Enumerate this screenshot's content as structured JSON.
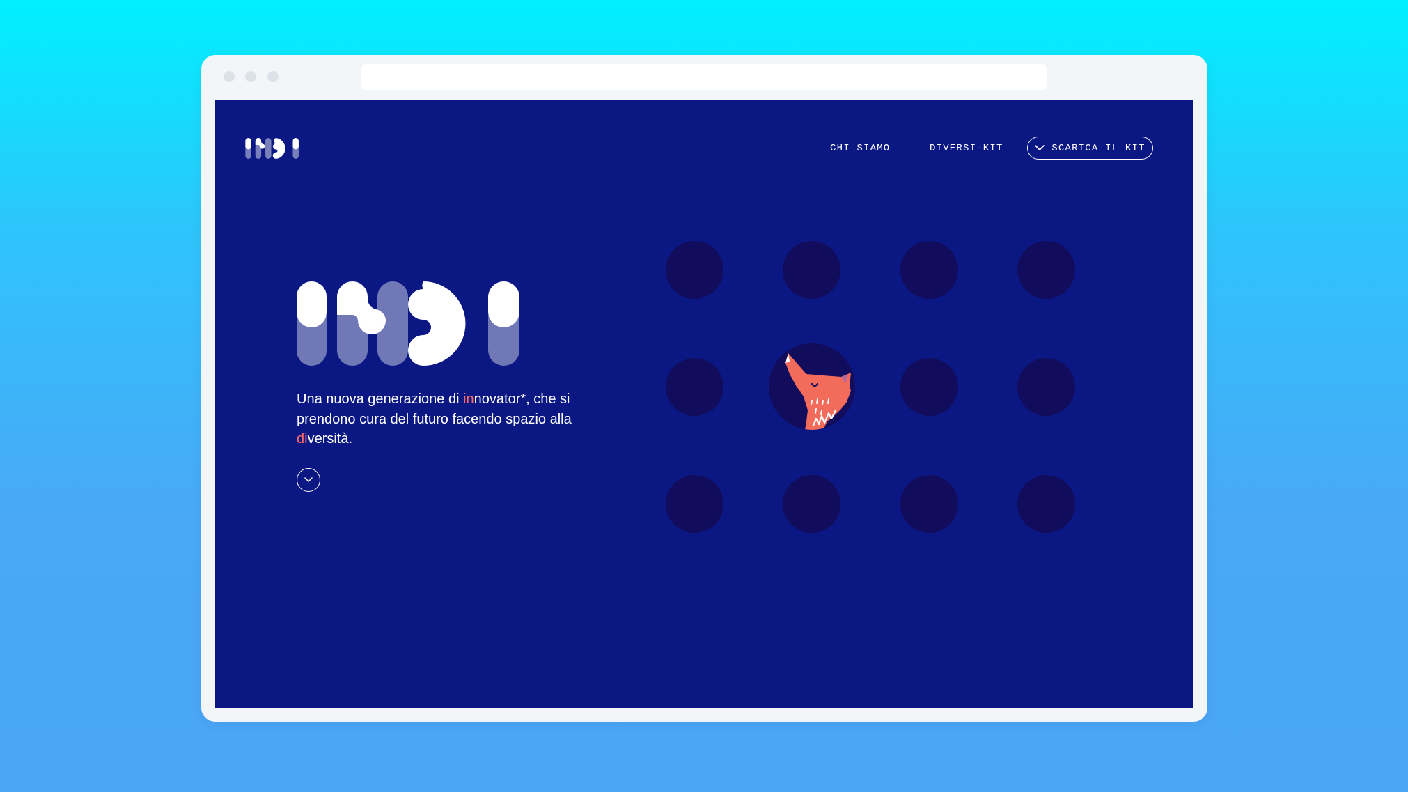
{
  "colors": {
    "page_background": "#0b1782",
    "dot": "#110c5b",
    "accent": "#ff6b6b",
    "fox": "#f26b5b",
    "text": "#ffffff"
  },
  "nav": {
    "logo_icon": "indi-logo",
    "links": [
      {
        "label": "CHI SIAMO"
      },
      {
        "label": "DIVERSI-KIT"
      }
    ],
    "kit_button": {
      "icon": "chevron-down-icon",
      "label": "SCARICA IL KIT"
    }
  },
  "hero": {
    "logo_icon": "indi-logo",
    "tagline": {
      "part1": "Una nuova generazione di ",
      "highlight1": "in",
      "part2": "novator*, che si prendono cura del futuro facendo spazio alla ",
      "highlight2": "di",
      "part3": "versità."
    },
    "scroll_icon": "chevron-down-icon"
  },
  "illustration": {
    "grid": "3 rows x 4 columns of dark circles",
    "featured_icon": "fox-icon"
  }
}
